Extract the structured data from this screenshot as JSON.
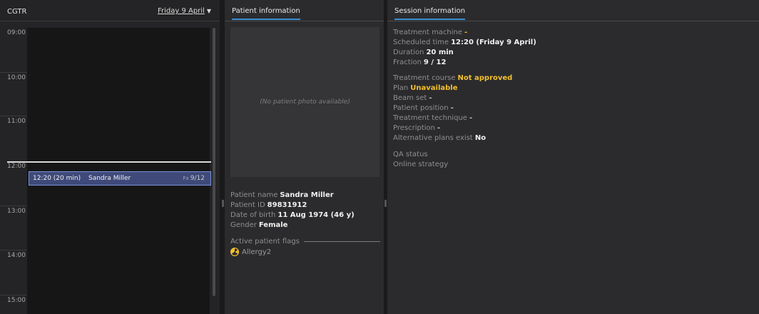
{
  "schedule": {
    "machine": "CGTR",
    "date": "Friday 9 April",
    "hours": [
      "09:00",
      "10:00",
      "11:00",
      "12:00",
      "13:00",
      "14:00",
      "15:00"
    ],
    "appointment": {
      "time": "12:20 (20 min)",
      "patient": "Sandra Miller",
      "fx_label": "Fx",
      "fx_value": "9/12"
    }
  },
  "patient": {
    "tab": "Patient information",
    "photo_placeholder": "(No patient photo available)",
    "fields": [
      {
        "label": "Patient name",
        "value": "Sandra Miller"
      },
      {
        "label": "Patient ID",
        "value": "89831912"
      },
      {
        "label": "Date of birth",
        "value": "11 Aug 1974 (46 y)"
      },
      {
        "label": "Gender",
        "value": "Female"
      }
    ],
    "flags_title": "Active patient flags",
    "flags": [
      {
        "name": "Allergy2",
        "icon": "radiation-icon"
      }
    ]
  },
  "session": {
    "tab": "Session information",
    "group1": [
      {
        "label": "Treatment machine",
        "value": "-"
      },
      {
        "label": "Scheduled time",
        "value": "12:20 (Friday 9 April)"
      },
      {
        "label": "Duration",
        "value": "20 min"
      },
      {
        "label": "Fraction",
        "value": "9 / 12"
      }
    ],
    "group2": [
      {
        "label": "Treatment course",
        "value": "Not approved"
      },
      {
        "label": "Plan",
        "value": "Unavailable"
      },
      {
        "label": "Beam set",
        "value": "-"
      },
      {
        "label": "Patient position",
        "value": "-"
      },
      {
        "label": "Treatment technique",
        "value": "-"
      },
      {
        "label": "Prescription",
        "value": "-"
      },
      {
        "label": "Alternative plans exist",
        "value": "No"
      }
    ],
    "group3": [
      {
        "label": "QA status",
        "value": ""
      },
      {
        "label": "Online strategy",
        "value": ""
      }
    ]
  },
  "colors": {
    "accent": "#3d8fd1",
    "warning": "#f2c02c",
    "appointment_fill": "#3f4a7a",
    "appointment_border": "#7a92d6"
  }
}
